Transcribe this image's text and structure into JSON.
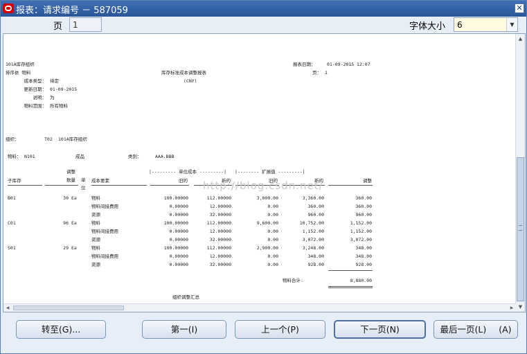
{
  "window": {
    "title": "报表：请求编号 － 587059",
    "close_glyph": "✕"
  },
  "toolbar": {
    "page_label": "页",
    "page_value": "1",
    "font_size_label": "字体大小",
    "font_size_value": "6"
  },
  "report": {
    "org_name": "101A库存组织",
    "report_date_label": "报表日期：",
    "report_date_value": "01-09-2015 12:07",
    "scope_line": "排序依  物料",
    "report_title": "库存标准成本调整报表",
    "currency": "(CNY)",
    "page_label": "页：",
    "page_value": "1",
    "params": [
      {
        "label": "成本类型：",
        "value": "待定"
      },
      {
        "label": "更新日期：",
        "value": "01-09-2015"
      },
      {
        "label": "说明：",
        "value": "为"
      },
      {
        "label": "物料范围：",
        "value": "所有物料"
      }
    ],
    "org_line_label": "组织：",
    "org_line_code": "T02",
    "org_line_name": "101A库存组织",
    "item_label": "物料：",
    "item_value": "N101",
    "item_desc": "成品",
    "category_label": "类别：",
    "category_value": "AAA.BBB",
    "headers": {
      "unit_cost_group": "|--------- 单位成本 ---------|",
      "extended_group": "|-------- 扩展值 ---------|",
      "subinventory": "子库存",
      "adjust_qty_line1": "调整",
      "adjust_qty_line2": "数量",
      "uom_line1": "单",
      "uom_line2": "位",
      "cost_element": "成本要素",
      "old": "旧的",
      "new": "新的",
      "ext_old": "旧的",
      "ext_new": "新的",
      "adjustment": "调整"
    },
    "groups": [
      {
        "sub": "B01",
        "qty": "30",
        "uom": "Ea",
        "rows": [
          {
            "element": "物料",
            "old": "100.00000",
            "new": "112.00000",
            "ext_old": "3,000.00",
            "ext_new": "3,360.00",
            "adj": "360.00"
          },
          {
            "element": "物料间接费用",
            "old": "0.00000",
            "new": "12.00000",
            "ext_old": "0.00",
            "ext_new": "360.00",
            "adj": "360.00"
          },
          {
            "element": "资源",
            "old": "0.00000",
            "new": "32.00000",
            "ext_old": "0.00",
            "ext_new": "960.00",
            "adj": "960.00"
          }
        ]
      },
      {
        "sub": "C01",
        "qty": "96",
        "uom": "Ea",
        "rows": [
          {
            "element": "物料",
            "old": "100.00000",
            "new": "112.00000",
            "ext_old": "9,600.00",
            "ext_new": "10,752.00",
            "adj": "1,152.00"
          },
          {
            "element": "物料间接费用",
            "old": "0.00000",
            "new": "12.00000",
            "ext_old": "0.00",
            "ext_new": "1,152.00",
            "adj": "1,152.00"
          },
          {
            "element": "资源",
            "old": "0.00000",
            "new": "32.00000",
            "ext_old": "0.00",
            "ext_new": "3,072.00",
            "adj": "3,072.00"
          }
        ]
      },
      {
        "sub": "S01",
        "qty": "29",
        "uom": "Ea",
        "rows": [
          {
            "element": "物料",
            "old": "100.00000",
            "new": "112.00000",
            "ext_old": "2,900.00",
            "ext_new": "3,248.00",
            "adj": "348.00"
          },
          {
            "element": "物料间接费用",
            "old": "0.00000",
            "new": "12.00000",
            "ext_old": "0.00",
            "ext_new": "348.00",
            "adj": "348.00"
          },
          {
            "element": "资源",
            "old": "0.00000",
            "new": "32.00000",
            "ext_old": "0.00",
            "ext_new": "928.00",
            "adj": "928.00"
          }
        ]
      }
    ],
    "total_label": "物料合计:",
    "total_value": "8,880.00",
    "summary_title": "组织调整汇总"
  },
  "watermark": "http://blog.csdn.net/",
  "buttons": {
    "goto": "转至(G)...",
    "first": "第一(I)",
    "prev": "上一个(P)",
    "next": "下一页(N)",
    "last": "最后一页(L)",
    "a": "(A)"
  }
}
